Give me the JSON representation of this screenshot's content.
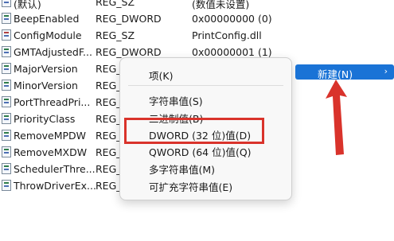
{
  "rows": [
    {
      "name": "(默认)",
      "type": "REG_SZ",
      "data": "(数值未设置)",
      "kind": "str"
    },
    {
      "name": "BeepEnabled",
      "type": "REG_DWORD",
      "data": "0x00000000 (0)",
      "kind": "bin"
    },
    {
      "name": "ConfigModule",
      "type": "REG_SZ",
      "data": "PrintConfig.dll",
      "kind": "str"
    },
    {
      "name": "GMTAdjustedF...",
      "type": "REG_DWORD",
      "data": "0x00000001 (1)",
      "kind": "bin"
    },
    {
      "name": "MajorVersion",
      "type": "REG_",
      "data": "",
      "kind": "bin"
    },
    {
      "name": "MinorVersion",
      "type": "REG_",
      "data": "",
      "kind": "bin"
    },
    {
      "name": "PortThreadPri...",
      "type": "REG_",
      "data": "",
      "kind": "bin"
    },
    {
      "name": "PriorityClass",
      "type": "REG_",
      "data": "",
      "kind": "bin"
    },
    {
      "name": "RemoveMPDW",
      "type": "REG_",
      "data": "",
      "kind": "bin"
    },
    {
      "name": "RemoveMXDW",
      "type": "REG_",
      "data": "",
      "kind": "bin"
    },
    {
      "name": "SchedulerThre...",
      "type": "REG_",
      "data": "",
      "kind": "bin"
    },
    {
      "name": "ThrowDriverEx...",
      "type": "REG_",
      "data": "",
      "kind": "bin"
    }
  ],
  "context_menu": {
    "key_item": "项(K)",
    "string_value": "字符串值(S)",
    "binary_value": "二进制值(B)",
    "dword_value": "DWORD (32 位)值(D)",
    "qword_value": "QWORD (64 位)值(Q)",
    "multi_string_value": "多字符串值(M)",
    "expandable_string_value": "可扩充字符串值(E)"
  },
  "submenu_trigger": {
    "label": "新建(N)",
    "chevron": "›"
  },
  "colors": {
    "highlight": "#1a73d6",
    "annotation_red": "#d9332b"
  }
}
